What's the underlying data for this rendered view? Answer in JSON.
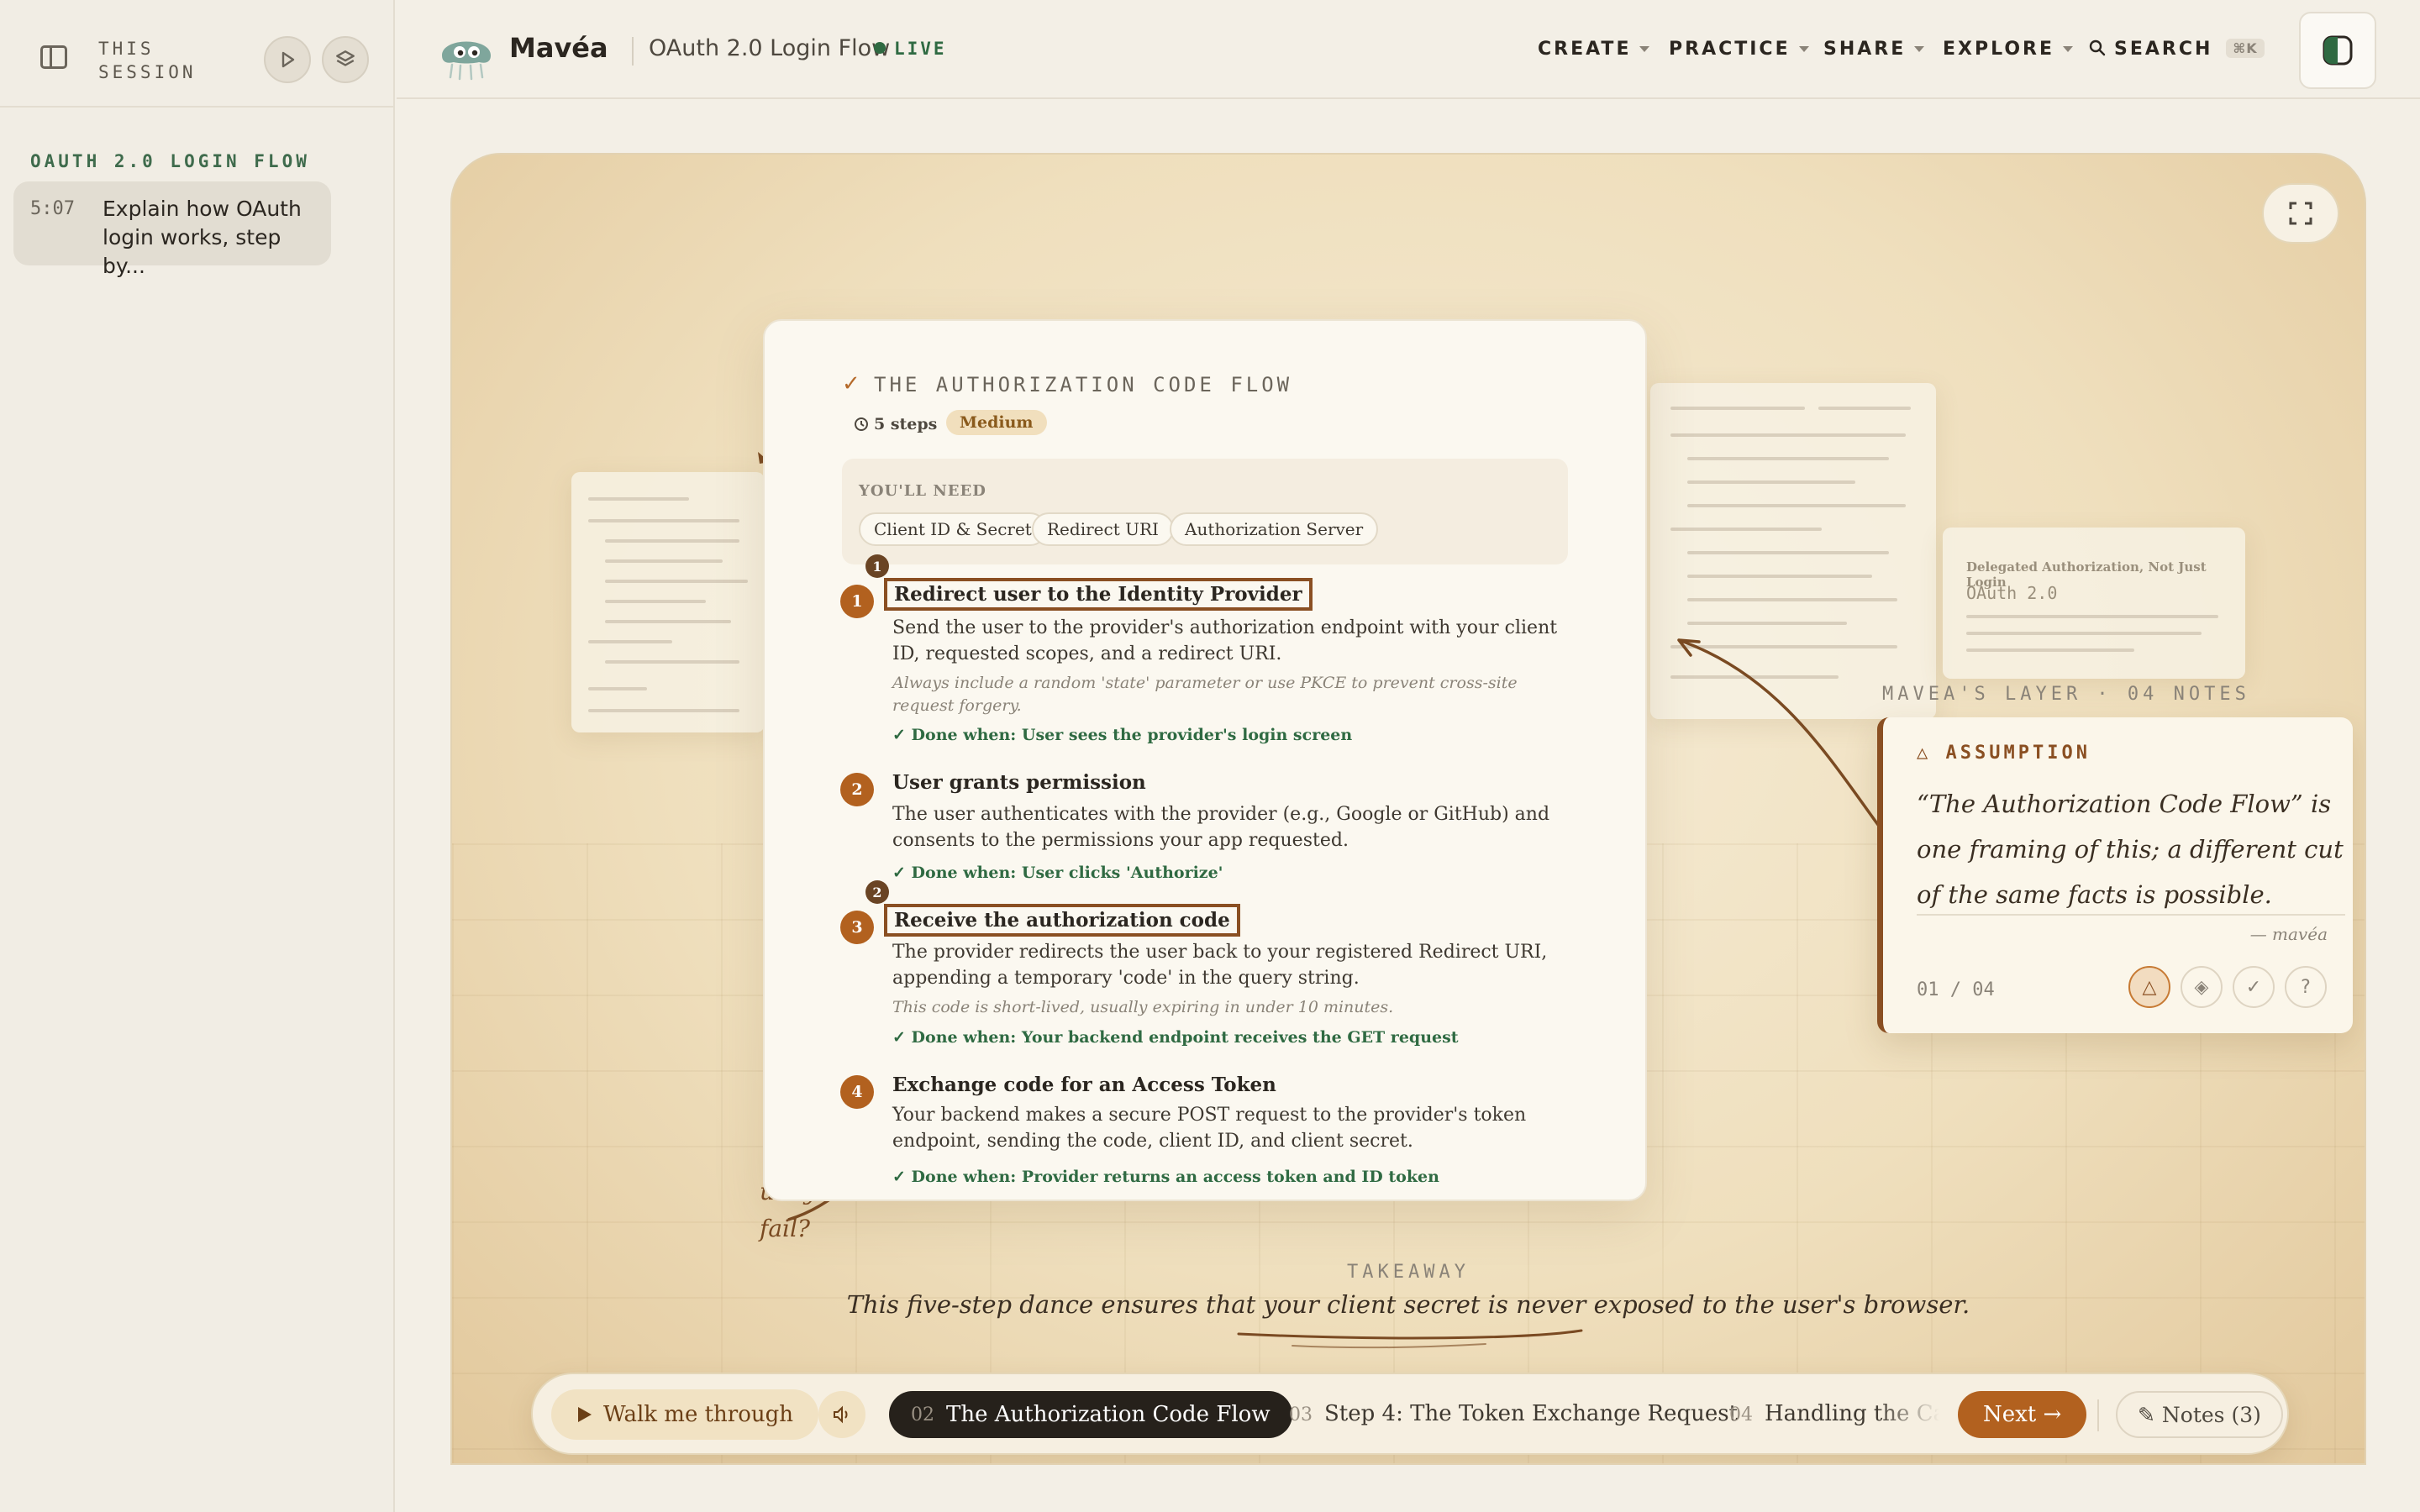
{
  "sidebar": {
    "title": "THIS SESSION",
    "section_label": "OAUTH 2.0 LOGIN FLOW",
    "items": [
      {
        "time": "5:07",
        "text": "Explain how OAuth login works, step by..."
      }
    ]
  },
  "header": {
    "brand": "Mavéa",
    "breadcrumb": "OAuth 2.0 Login Flow",
    "live": "LIVE",
    "nav": [
      "CREATE",
      "PRACTICE",
      "SHARE",
      "EXPLORE"
    ],
    "search_label": "SEARCH",
    "search_shortcut": "⌘K"
  },
  "card": {
    "title": "THE AUTHORIZATION CODE FLOW",
    "steps_count": "5 steps",
    "difficulty": "Medium",
    "need_label": "YOU'LL NEED",
    "needs": [
      "Client ID & Secret",
      "Redirect URI",
      "Authorization Server"
    ],
    "steps": [
      {
        "num": "1",
        "title": "Redirect user to the Identity Provider",
        "desc": "Send the user to the provider's authorization endpoint with your client ID, requested scopes, and a redirect URI.",
        "note": "Always include a random 'state' parameter or use PKCE to prevent cross-site request forgery.",
        "done": "Done when: User sees the provider's login screen",
        "badge": "1"
      },
      {
        "num": "2",
        "title": "User grants permission",
        "desc": "The user authenticates with the provider (e.g., Google or GitHub) and consents to the permissions your app requested.",
        "done": "Done when: User clicks 'Authorize'"
      },
      {
        "num": "3",
        "title": "Receive the authorization code",
        "desc": "The provider redirects the user back to your registered Redirect URI, appending a temporary 'code' in the query string.",
        "note": "This code is short-lived, usually expiring in under 10 minutes.",
        "done": "Done when: Your backend endpoint receives the GET request",
        "badge": "2"
      },
      {
        "num": "4",
        "title": "Exchange code for an Access Token",
        "desc": "Your backend makes a secure POST request to the provider's token endpoint, sending the code, client ID, and client secret.",
        "done": "Done when: Provider returns an access token and ID token"
      }
    ]
  },
  "ghosts": {
    "right_title": "Delegated Authorization, Not Just Login",
    "right_sub": "OAuth 2.0"
  },
  "layer": {
    "label": "MAVEA'S LAYER · 04 NOTES",
    "kind": "ASSUMPTION",
    "text": "“The Authorization Code Flow” is one framing of this; a different cut of the same facts is possible.",
    "signature": "— mavéa",
    "counter": "01 / 04",
    "buttons": [
      "△",
      "◈",
      "✓",
      "?"
    ]
  },
  "scribble": {
    "line1": "ually",
    "line2": "fail?"
  },
  "takeaway": {
    "label": "TAKEAWAY",
    "text": "This five-step dance ensures that your client secret is never exposed to the user's browser."
  },
  "bottombar": {
    "walk": "Walk me through",
    "current_num": "02",
    "current_title": "The Authorization Code Flow",
    "chapters": [
      {
        "num": "03",
        "title": "Step 4: The Token Exchange Request"
      },
      {
        "num": "04",
        "title": "Handling the Callback"
      }
    ],
    "next": "Next →",
    "notes": "✎ Notes (3)"
  },
  "colors": {
    "accent": "#b2611f",
    "success": "#2f6a42",
    "ink": "#2b2620"
  }
}
